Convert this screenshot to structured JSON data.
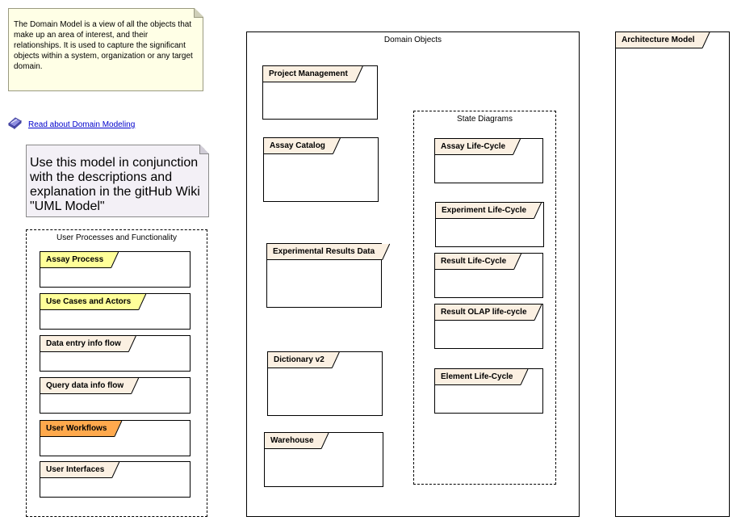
{
  "notes": {
    "domain_model_note": "The Domain Model is a view of all the objects that make up an area of interest, and their relationships.  It  is used to capture the significant objects within a system, organization or any target domain.",
    "usage_note": "Use this model in conjunction with the descriptions and explanation in the gitHub Wiki \"UML Model\""
  },
  "link": {
    "label": "Read about Domain Modeling"
  },
  "user_processes": {
    "title": "User Processes and Functionality",
    "frames": [
      {
        "label": "Assay Process",
        "color": "#ffff99"
      },
      {
        "label": "Use Cases and Actors",
        "color": "#ffff99"
      },
      {
        "label": "Data entry info flow",
        "color": "#fbf0e2"
      },
      {
        "label": "Query data info flow",
        "color": "#fbf0e2"
      },
      {
        "label": "User Workflows",
        "color": "#ffa94d"
      },
      {
        "label": "User Interfaces",
        "color": "#fbf0e2"
      }
    ]
  },
  "domain_objects": {
    "title": "Domain Objects",
    "frames": [
      {
        "label": "Project Management"
      },
      {
        "label": "Assay Catalog"
      },
      {
        "label": "Experimental Results Data"
      },
      {
        "label": "Dictionary v2"
      },
      {
        "label": "Warehouse"
      }
    ]
  },
  "state_diagrams": {
    "title": "State Diagrams",
    "frames": [
      {
        "label": "Assay Life-Cycle"
      },
      {
        "label": "Experiment Life-Cycle"
      },
      {
        "label": "Result Life-Cycle"
      },
      {
        "label": "Result OLAP life-cycle"
      },
      {
        "label": "Element Life-Cycle"
      }
    ]
  },
  "architecture_model": {
    "label": "Architecture Model"
  }
}
